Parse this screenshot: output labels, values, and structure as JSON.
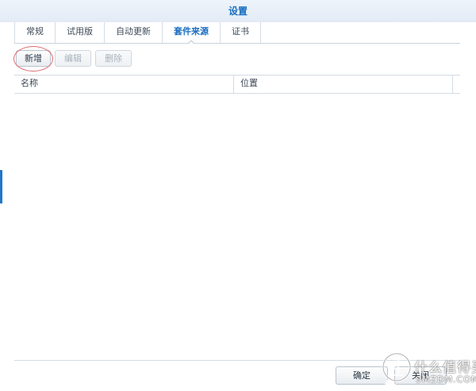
{
  "window": {
    "title": "设置"
  },
  "tabs": [
    {
      "label": "常规"
    },
    {
      "label": "试用版"
    },
    {
      "label": "自动更新"
    },
    {
      "label": "套件来源",
      "active": true
    },
    {
      "label": "证书"
    }
  ],
  "toolbar": {
    "add_label": "新增",
    "edit_label": "编辑",
    "delete_label": "删除"
  },
  "table": {
    "columns": [
      "名称",
      "位置"
    ],
    "rows": []
  },
  "footer": {
    "ok_label": "确定",
    "close_label": "关闭"
  },
  "watermark": {
    "text": "什么值得买",
    "site": "SMZDM.COM"
  },
  "colors": {
    "accent": "#1b6fc0",
    "highlight_ring": "#e06b72"
  }
}
